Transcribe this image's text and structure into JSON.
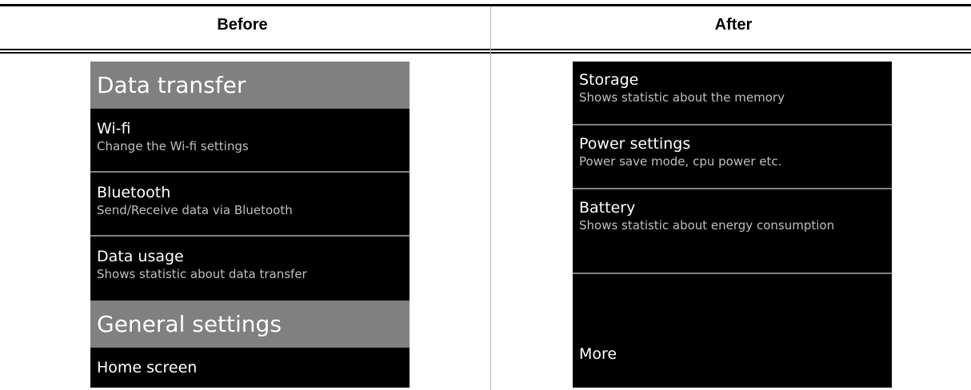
{
  "columns": {
    "before": "Before",
    "after": "After"
  },
  "before_screen": {
    "sections": [
      {
        "header": "Data transfer",
        "items": [
          {
            "title": "Wi-fi",
            "description": "Change the Wi-fi settings"
          },
          {
            "title": "Bluetooth",
            "description": "Send/Receive data via Bluetooth"
          },
          {
            "title": "Data usage",
            "description": "Shows statistic about data transfer"
          }
        ]
      },
      {
        "header": "General settings",
        "items": [
          {
            "title": "Home screen",
            "description": ""
          }
        ]
      }
    ]
  },
  "after_screen": {
    "items": [
      {
        "title": "Storage",
        "description": "Shows statistic about the memory"
      },
      {
        "title": "Power settings",
        "description": "Power save mode, cpu power etc."
      },
      {
        "title": "Battery",
        "description": "Shows statistic about energy consumption"
      }
    ],
    "more_label": "More"
  }
}
